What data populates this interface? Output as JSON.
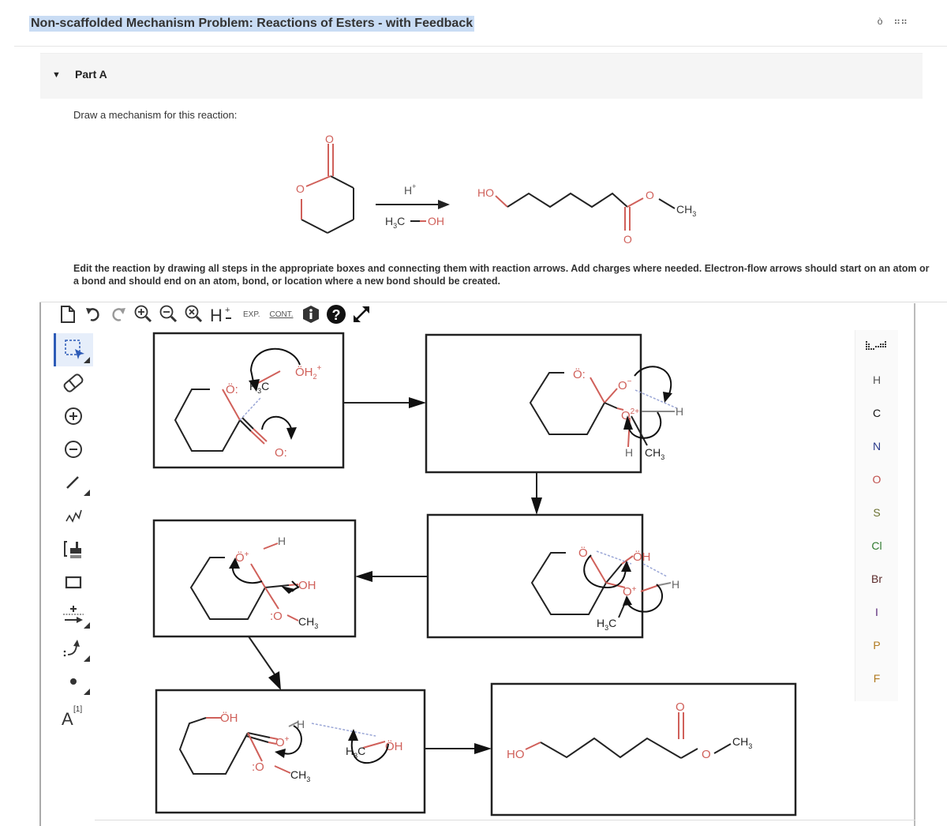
{
  "header": {
    "title": "Non-scaffolded Mechanism Problem: Reactions of Esters - with Feedback",
    "icons": [
      "document-icon",
      "grid-icon",
      "grid-icon"
    ]
  },
  "part": {
    "label": "Part A",
    "expanded": true
  },
  "prompt": "Draw a mechanism for this reaction:",
  "reaction": {
    "reactant": "delta-valerolactone",
    "reagent_top": "H",
    "reagent_top_sup": "+",
    "reagent_bottom_left": "H",
    "reagent_bottom_sub": "3",
    "reagent_bottom_c": "C",
    "reagent_bottom_right": "OH",
    "product_ho": "HO",
    "product_o": "O",
    "product_carbonyl_o": "O",
    "product_ch": "CH",
    "product_sub": "3",
    "lactone_o": "O",
    "lactone_carbonyl_o": "O"
  },
  "instructions": "Edit the reaction by drawing all steps in the appropriate boxes and connecting them with reaction arrows. Add charges where needed. Electron-flow arrows should start on an atom or a bond and should end on an atom, bond, or location where a new bond should be created.",
  "toolbar": {
    "items": [
      {
        "name": "new-document-icon",
        "glyph": "🗋"
      },
      {
        "name": "undo-icon",
        "glyph": "↶"
      },
      {
        "name": "redo-icon",
        "glyph": "↷"
      },
      {
        "name": "zoom-in-icon",
        "glyph": "⊕"
      },
      {
        "name": "zoom-out-icon",
        "glyph": "⊖"
      },
      {
        "name": "zoom-reset-icon",
        "glyph": "⊗"
      },
      {
        "name": "hydrogen-toggle-icon",
        "glyph": "H±"
      }
    ],
    "exp_label": "EXP.",
    "cont_label": "CONT.",
    "info_glyph": "i",
    "help_glyph": "?",
    "expand_glyph": "⤢"
  },
  "left_tools": [
    {
      "name": "select-tool",
      "glyph": "⬚"
    },
    {
      "name": "eraser-tool",
      "glyph": "⌫"
    },
    {
      "name": "positive-charge-tool",
      "glyph": "⊕"
    },
    {
      "name": "negative-charge-tool",
      "glyph": "⊖"
    },
    {
      "name": "bond-tool",
      "glyph": "╱"
    },
    {
      "name": "chain-tool",
      "glyph": "⩘"
    },
    {
      "name": "template-tool",
      "glyph": "[▟"
    },
    {
      "name": "rectangle-tool",
      "glyph": "▭"
    },
    {
      "name": "reaction-arrow-tool",
      "glyph": "+→"
    },
    {
      "name": "electron-flow-arrow-tool",
      "glyph": ":↷"
    },
    {
      "name": "radical-tool",
      "glyph": "•"
    },
    {
      "name": "atom-map-tool",
      "glyph": "A[1]"
    }
  ],
  "elements": [
    {
      "symbol": "H",
      "color": "#555555"
    },
    {
      "symbol": "C",
      "color": "#111111"
    },
    {
      "symbol": "N",
      "color": "#2a3a8a"
    },
    {
      "symbol": "O",
      "color": "#c0504d"
    },
    {
      "symbol": "S",
      "color": "#6a7030"
    },
    {
      "symbol": "Cl",
      "color": "#2f7a2f"
    },
    {
      "symbol": "Br",
      "color": "#5a2a2a"
    },
    {
      "symbol": "I",
      "color": "#5a2a7a"
    },
    {
      "symbol": "P",
      "color": "#b07a20"
    },
    {
      "symbol": "F",
      "color": "#b07a20"
    }
  ],
  "periodic_table_icon": "periodic-table-icon",
  "steps": {
    "box1": {
      "oh2": "ÖH",
      "oh2_sub": "2",
      "oh2_sup": "+",
      "ring_o": "Ö:",
      "h3c": "H",
      "h3c_sub": "3",
      "h3c_c": "C",
      "carbonyl_o": "O:"
    },
    "box2": {
      "ring_o": "Ö:",
      "o_minus": "O",
      "o_minus_sup": "−",
      "o2plus": "O",
      "o2plus_sup": "2+",
      "h_right": "H",
      "h_bottom": "H",
      "ch3": "CH",
      "ch3_sub": "3"
    },
    "box3": {
      "ring_o": "Ö",
      "ring_o_sup": "+",
      "h": "H",
      "oh": "OH",
      "o": ":O",
      "ch3": "CH",
      "ch3_sub": "3"
    },
    "box4": {
      "ring_o": "Ö",
      "oh": "ÖH",
      "o_plus": "O",
      "o_plus_sup": "+",
      "h": "H",
      "h3c": "H",
      "h3c_sub": "3",
      "h3c_c": "C"
    },
    "box5": {
      "oh": "ÖH",
      "o_plus": "O",
      "o_plus_sup": "+",
      "h": "H",
      "o": ":O",
      "ch3": "CH",
      "ch3_sub": "3",
      "h3c": "H",
      "h3c_sub": "3",
      "h3c_c": "C",
      "methanol_oh": "ÖH"
    },
    "box6": {
      "ho": "HO",
      "carbonyl_o": "O",
      "ester_o": "O",
      "ch3": "CH",
      "ch3_sub": "3"
    }
  },
  "colors": {
    "oxygen": "#d0605a",
    "bond": "#222222",
    "hydrogen": "#666666",
    "dashed": "#9aa6d6",
    "highlight": "#c9dcf4",
    "active_tool": "#2d5bb7"
  }
}
